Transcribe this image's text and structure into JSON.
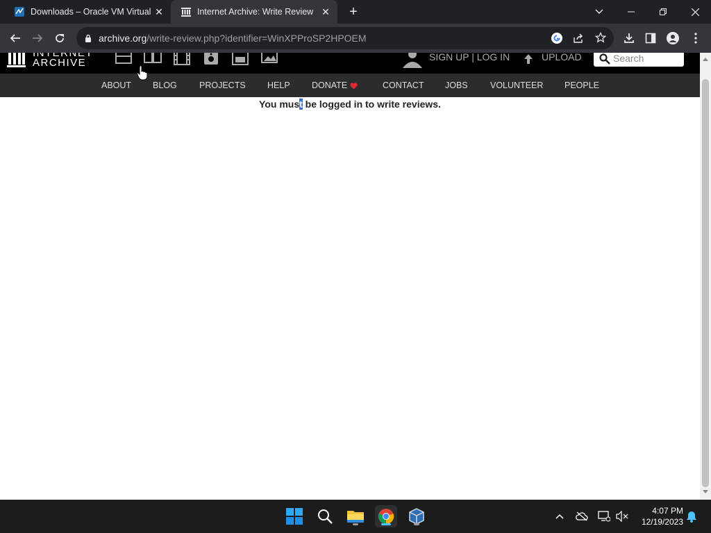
{
  "browser": {
    "tabs": [
      {
        "title": "Downloads – Oracle VM VirtualBox",
        "active": false
      },
      {
        "title": "Internet Archive: Write Review",
        "active": true
      }
    ],
    "url_host": "archive.org",
    "url_path": "/write-review.php?identifier=WinXPProSP2HPOEM",
    "colors": {
      "chrome_dark": "#202124",
      "chrome_toolbar": "#35363a"
    }
  },
  "site": {
    "logo_line1": "INTERNET",
    "logo_line2": "ARCHIVE",
    "media_icons": [
      "web-icon",
      "texts-icon",
      "video-icon",
      "audio-icon",
      "software-icon",
      "images-icon"
    ],
    "signup_login": "SIGN UP | LOG IN",
    "upload": "UPLOAD",
    "search_placeholder": "Search",
    "nav": [
      "ABOUT",
      "BLOG",
      "PROJECTS",
      "HELP",
      "DONATE",
      "CONTACT",
      "JOBS",
      "VOLUNTEER",
      "PEOPLE"
    ],
    "donate_heart_color": "#e0282e",
    "message_before": "You mus",
    "message_selected": "t",
    "message_after": " be logged in to write reviews."
  },
  "taskbar": {
    "apps": [
      "windows-start-icon",
      "search-icon",
      "file-explorer-icon",
      "chrome-icon",
      "virtualbox-icon"
    ],
    "time": "4:07 PM",
    "date": "12/19/2023"
  }
}
